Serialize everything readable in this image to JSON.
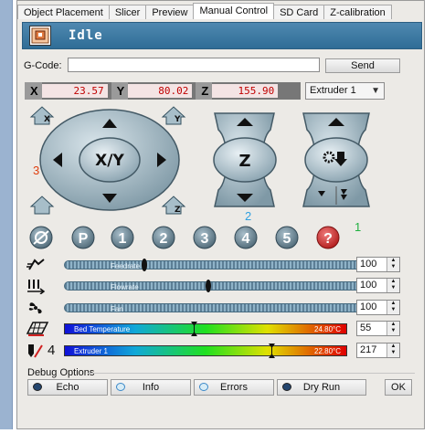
{
  "tabs": [
    "Object Placement",
    "Slicer",
    "Preview",
    "Manual Control",
    "SD Card",
    "Z-calibration"
  ],
  "active_tab": "Manual Control",
  "status": {
    "text": "Idle",
    "icon": "printer-status-icon"
  },
  "gcode": {
    "label": "G-Code:",
    "value": "",
    "send_label": "Send"
  },
  "coords": {
    "x_label": "X",
    "x_value": "23.57",
    "y_label": "Y",
    "y_value": "80.02",
    "z_label": "Z",
    "z_value": "155.90"
  },
  "extruder_select": {
    "value": "Extruder 1"
  },
  "jog": {
    "xy_label": "X/Y",
    "z_label": "Z",
    "home_x_label": "X",
    "home_y_label": "Y",
    "home_z_label": "Z"
  },
  "annotations": {
    "a1": "1",
    "a2": "2",
    "a3": "3",
    "a4": "4"
  },
  "shortcuts": [
    "1",
    "2",
    "3",
    "4",
    "5",
    "?"
  ],
  "shortcut_p": "P",
  "sliders": [
    {
      "label": "Feedrate",
      "value": "100",
      "level": 0.25
    },
    {
      "label": "Flowrate",
      "value": "100",
      "level": 0.46
    },
    {
      "label": "Fan",
      "value": "100",
      "level": 1.0
    }
  ],
  "temps": [
    {
      "label": "Bed Temperature",
      "reading": "24.80°C",
      "target": "55",
      "marker": 0.46
    },
    {
      "label": "Extruder 1",
      "reading": "22.80°C",
      "target": "217",
      "marker": 0.74
    }
  ],
  "debug": {
    "title": "Debug Options",
    "buttons": [
      {
        "label": "Echo",
        "active": true
      },
      {
        "label": "Info",
        "active": false
      },
      {
        "label": "Errors",
        "active": false
      },
      {
        "label": "Dry Run",
        "active": true
      }
    ],
    "ok_label": "OK"
  },
  "colors": {
    "status_bar": "#3a79a3",
    "coord_text": "#c00000",
    "led_on": "#24466f",
    "led_off": "#d8ecf6",
    "help_red": "#d42a2a",
    "annot_red": "#e04010",
    "annot_blue": "#30a0e0",
    "annot_green": "#20b040"
  }
}
